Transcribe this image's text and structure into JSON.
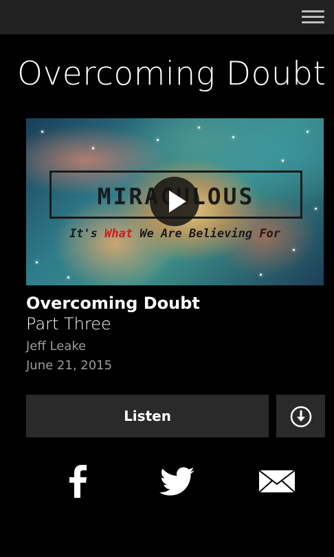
{
  "header": {
    "menu_icon": "hamburger-menu-icon"
  },
  "page": {
    "title": "Overcoming Doubt"
  },
  "artwork": {
    "heading": "MIRACULOUS",
    "subtitle_part1": "It's ",
    "subtitle_part2": "What",
    "subtitle_part3": " We Are Believing For",
    "play_icon": "play-icon"
  },
  "episode": {
    "title": "Overcoming Doubt",
    "subtitle": "Part Three",
    "speaker": "Jeff Leake",
    "date": "June 21, 2015"
  },
  "actions": {
    "listen_label": "Listen",
    "download_icon": "download-icon"
  },
  "share": {
    "icons": [
      "facebook-icon",
      "twitter-icon",
      "email-icon"
    ]
  },
  "colors": {
    "background": "#000000",
    "topbar": "#212121",
    "button": "#2a2a2a",
    "muted_text": "#9c9c9c",
    "accent_red": "#c81e1e"
  }
}
